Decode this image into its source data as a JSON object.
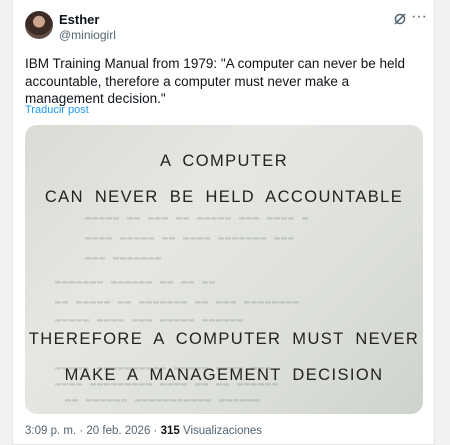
{
  "author": {
    "name": "Esther",
    "handle": "@miniogirl"
  },
  "header_icons": [
    "grok-icon",
    "more-icon"
  ],
  "post": {
    "text": "IBM Training Manual from 1979: \"A computer can never be held accountable, therefore a computer must never make a management decision.\"",
    "translate_label": "Traducir post"
  },
  "media": {
    "lines": [
      "A COMPUTER",
      "CAN NEVER BE HELD ACCOUNTABLE",
      "THEREFORE A COMPUTER MUST NEVER",
      "MAKE A MANAGEMENT DECISION"
    ]
  },
  "footer": {
    "time": "3:09 p. m.",
    "sep1": "·",
    "date": "20 feb. 2026",
    "sep2": "·",
    "views_count": "315",
    "views_label": "Visualizaciones"
  }
}
